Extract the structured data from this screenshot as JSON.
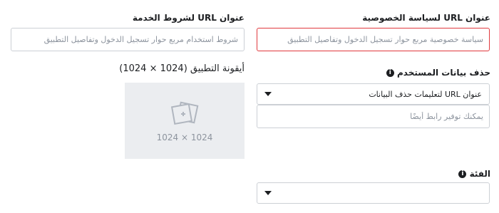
{
  "privacy": {
    "label": "عنوان URL لسياسة الخصوصية",
    "placeholder": "سياسة خصوصية مربع حوار تسجيل الدخول وتفاصيل التطبيق"
  },
  "terms": {
    "label": "عنوان URL لشروط الخدمة",
    "placeholder": "شروط استخدام مربع حوار تسجيل الدخول وتفاصيل التطبيق"
  },
  "deletion": {
    "label": "حذف بيانات المستخدم",
    "select_value": "عنوان URL لتعليمات حذف البيانات",
    "placeholder": "يمكنك توفير رابط أيضًا"
  },
  "app_icon": {
    "label": "أيقونة التطبيق (1024 × 1024)",
    "dims": "1024 × 1024"
  },
  "category": {
    "label": "الفئة",
    "select_value": ""
  },
  "info_icon_glyph": "i",
  "colors": {
    "error_border": "#e0393e",
    "icon_placeholder_bg": "#ebedf0"
  }
}
